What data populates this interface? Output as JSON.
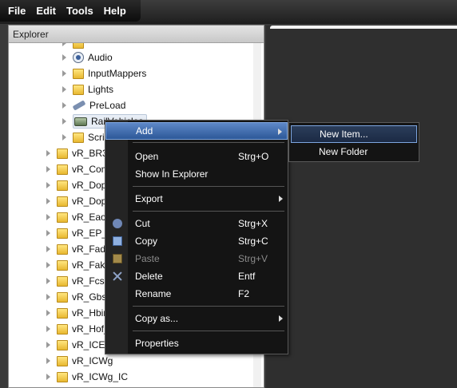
{
  "menubar": {
    "items": [
      "File",
      "Edit",
      "Tools",
      "Help"
    ]
  },
  "explorer": {
    "title": "Explorer",
    "tree": [
      {
        "label": "Audio",
        "icon": "audio-icon",
        "level": 2
      },
      {
        "label": "InputMappers",
        "icon": "folder-icon",
        "level": 2
      },
      {
        "label": "Lights",
        "icon": "folder-icon",
        "level": 2
      },
      {
        "label": "PreLoad",
        "icon": "wrench-icon",
        "level": 2
      },
      {
        "label": "RailVehicles",
        "icon": "railvehicle-icon",
        "level": 2,
        "selected": true
      },
      {
        "label": "Scripts",
        "icon": "folder-icon",
        "level": 2
      },
      {
        "label": "vR_BR32",
        "icon": "folder-icon",
        "level": 1
      },
      {
        "label": "vR_Com",
        "icon": "folder-icon",
        "level": 1
      },
      {
        "label": "vR_Dop",
        "icon": "folder-icon",
        "level": 1
      },
      {
        "label": "vR_Dop",
        "icon": "folder-icon",
        "level": 1
      },
      {
        "label": "vR_Eaos",
        "icon": "folder-icon",
        "level": 1
      },
      {
        "label": "vR_EP_Y",
        "icon": "folder-icon",
        "level": 1
      },
      {
        "label": "vR_Fad1",
        "icon": "folder-icon",
        "level": 1
      },
      {
        "label": "vR_Fakk",
        "icon": "folder-icon",
        "level": 1
      },
      {
        "label": "vR_Fcs0",
        "icon": "folder-icon",
        "level": 1
      },
      {
        "label": "vR_Gbs2",
        "icon": "folder-icon",
        "level": 1
      },
      {
        "label": "vR_Hbir",
        "icon": "folder-icon",
        "level": 1
      },
      {
        "label": "vR_Hof_",
        "icon": "folder-icon",
        "level": 1
      },
      {
        "label": "vR_ICE1",
        "icon": "folder-icon",
        "level": 1
      },
      {
        "label": "vR_ICWg",
        "icon": "folder-icon",
        "level": 1
      },
      {
        "label": "vR_ICWg_IC",
        "icon": "folder-icon",
        "level": 1
      }
    ]
  },
  "context_menu": {
    "add": {
      "label": "Add",
      "highlighted": true
    },
    "open": {
      "label": "Open",
      "shortcut": "Strg+O"
    },
    "show_in_explorer": {
      "label": "Show In Explorer"
    },
    "export": {
      "label": "Export"
    },
    "cut": {
      "label": "Cut",
      "shortcut": "Strg+X",
      "icon": "cut-icon"
    },
    "copy": {
      "label": "Copy",
      "shortcut": "Strg+C",
      "icon": "copy-icon"
    },
    "paste": {
      "label": "Paste",
      "shortcut": "Strg+V",
      "icon": "paste-icon",
      "disabled": true
    },
    "delete": {
      "label": "Delete",
      "shortcut": "Entf",
      "icon": "delete-icon"
    },
    "rename": {
      "label": "Rename",
      "shortcut": "F2"
    },
    "copy_as": {
      "label": "Copy as..."
    },
    "properties": {
      "label": "Properties"
    }
  },
  "submenu": {
    "new_item": {
      "label": "New Item...",
      "highlighted": true
    },
    "new_folder": {
      "label": "New Folder"
    }
  },
  "colors": {
    "highlight": "#3d6fb8",
    "menu_bg": "#141414",
    "folder": "#f0c850"
  }
}
